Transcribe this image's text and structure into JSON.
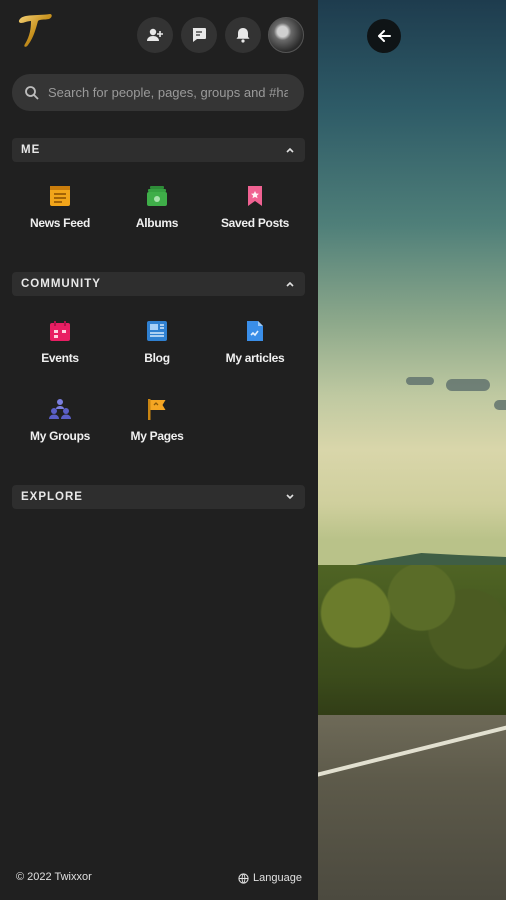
{
  "search": {
    "placeholder": "Search for people, pages, groups and #hashtags"
  },
  "sections": {
    "me": {
      "title": "ME",
      "items": [
        {
          "label": "News Feed",
          "icon": "news-feed-icon"
        },
        {
          "label": "Albums",
          "icon": "albums-icon"
        },
        {
          "label": "Saved Posts",
          "icon": "saved-posts-icon"
        }
      ]
    },
    "community": {
      "title": "COMMUNITY",
      "items": [
        {
          "label": "Events",
          "icon": "events-icon"
        },
        {
          "label": "Blog",
          "icon": "blog-icon"
        },
        {
          "label": "My articles",
          "icon": "articles-icon"
        },
        {
          "label": "My Groups",
          "icon": "groups-icon"
        },
        {
          "label": "My Pages",
          "icon": "pages-flag-icon"
        }
      ]
    },
    "explore": {
      "title": "EXPLORE"
    }
  },
  "footer": {
    "copyright": "© 2022 Twixxor",
    "language": "Language"
  },
  "colors": {
    "panel_bg": "#202020",
    "news_feed": "#f2a51a",
    "albums": "#3fae49",
    "saved_posts": "#f06292",
    "events": "#e91e63",
    "blog": "#2f80d1",
    "articles": "#3a8ee8",
    "groups": "#5b5fc7",
    "pages": "#f5a623"
  }
}
